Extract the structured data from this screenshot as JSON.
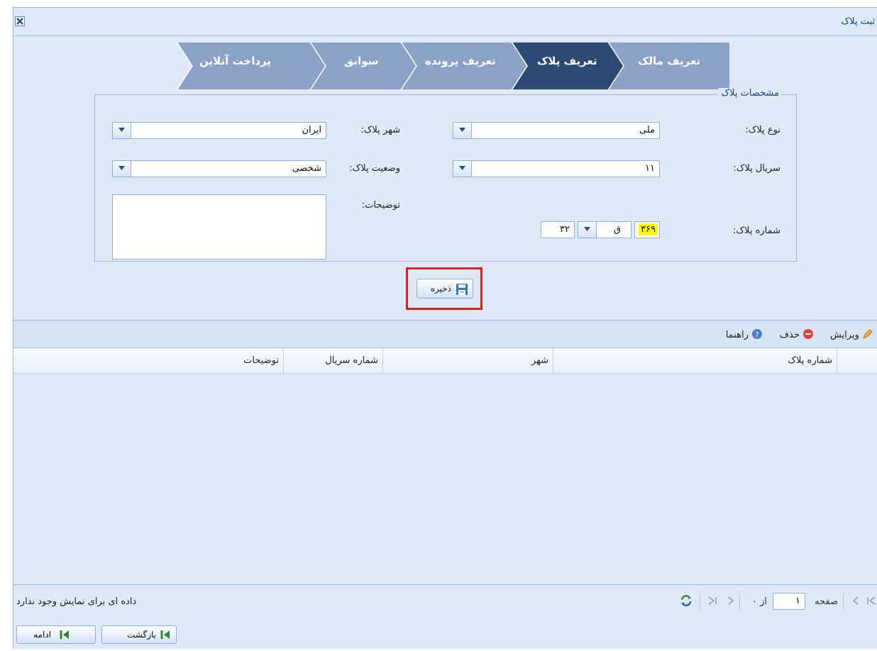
{
  "window": {
    "title": "ثبت پلاک"
  },
  "tabs": [
    {
      "label": "تعریف مالک",
      "active": false
    },
    {
      "label": "تعریف پلاک",
      "active": true
    },
    {
      "label": "تعریف پرونده",
      "active": false
    },
    {
      "label": "سوابق",
      "active": false
    },
    {
      "label": "پرداخت آنلاین",
      "active": false
    }
  ],
  "fieldset": {
    "legend": "مشخصات پلاک",
    "plate_type_label": "نوع پلاک:",
    "plate_type_value": "ملی",
    "plate_city_label": "شهر پلاک:",
    "plate_city_value": "ایران",
    "plate_serial_label": "سریال پلاک:",
    "plate_serial_value": "۱۱",
    "plate_status_label": "وضعیت پلاک:",
    "plate_status_value": "شخصی",
    "description_label": "توضیحات:",
    "plate_number_label": "شماره پلاک:",
    "plate_number_main": "۳۶۹",
    "plate_letter": "ق",
    "plate_number_tail": "۳۲"
  },
  "save_button": {
    "label": "ذخیره"
  },
  "toolbar": {
    "edit": "ویرایش",
    "delete": "حذف",
    "help": "راهنما"
  },
  "grid": {
    "columns": [
      "شماره پلاک",
      "شهر",
      "شماره سریال",
      "توضیحات"
    ]
  },
  "pager": {
    "page_label": "صفحه",
    "page_value": "۱",
    "of_label": "از ۰",
    "empty_text": "داده ای برای نمایش وجود ندارد"
  },
  "footer": {
    "back": "بازگشت",
    "continue": "ادامه"
  },
  "colors": {
    "active_tab": "#2b4a74",
    "inactive_tab": "#8aa2c7",
    "highlight": "#ffff00",
    "frame": "#e02020"
  }
}
